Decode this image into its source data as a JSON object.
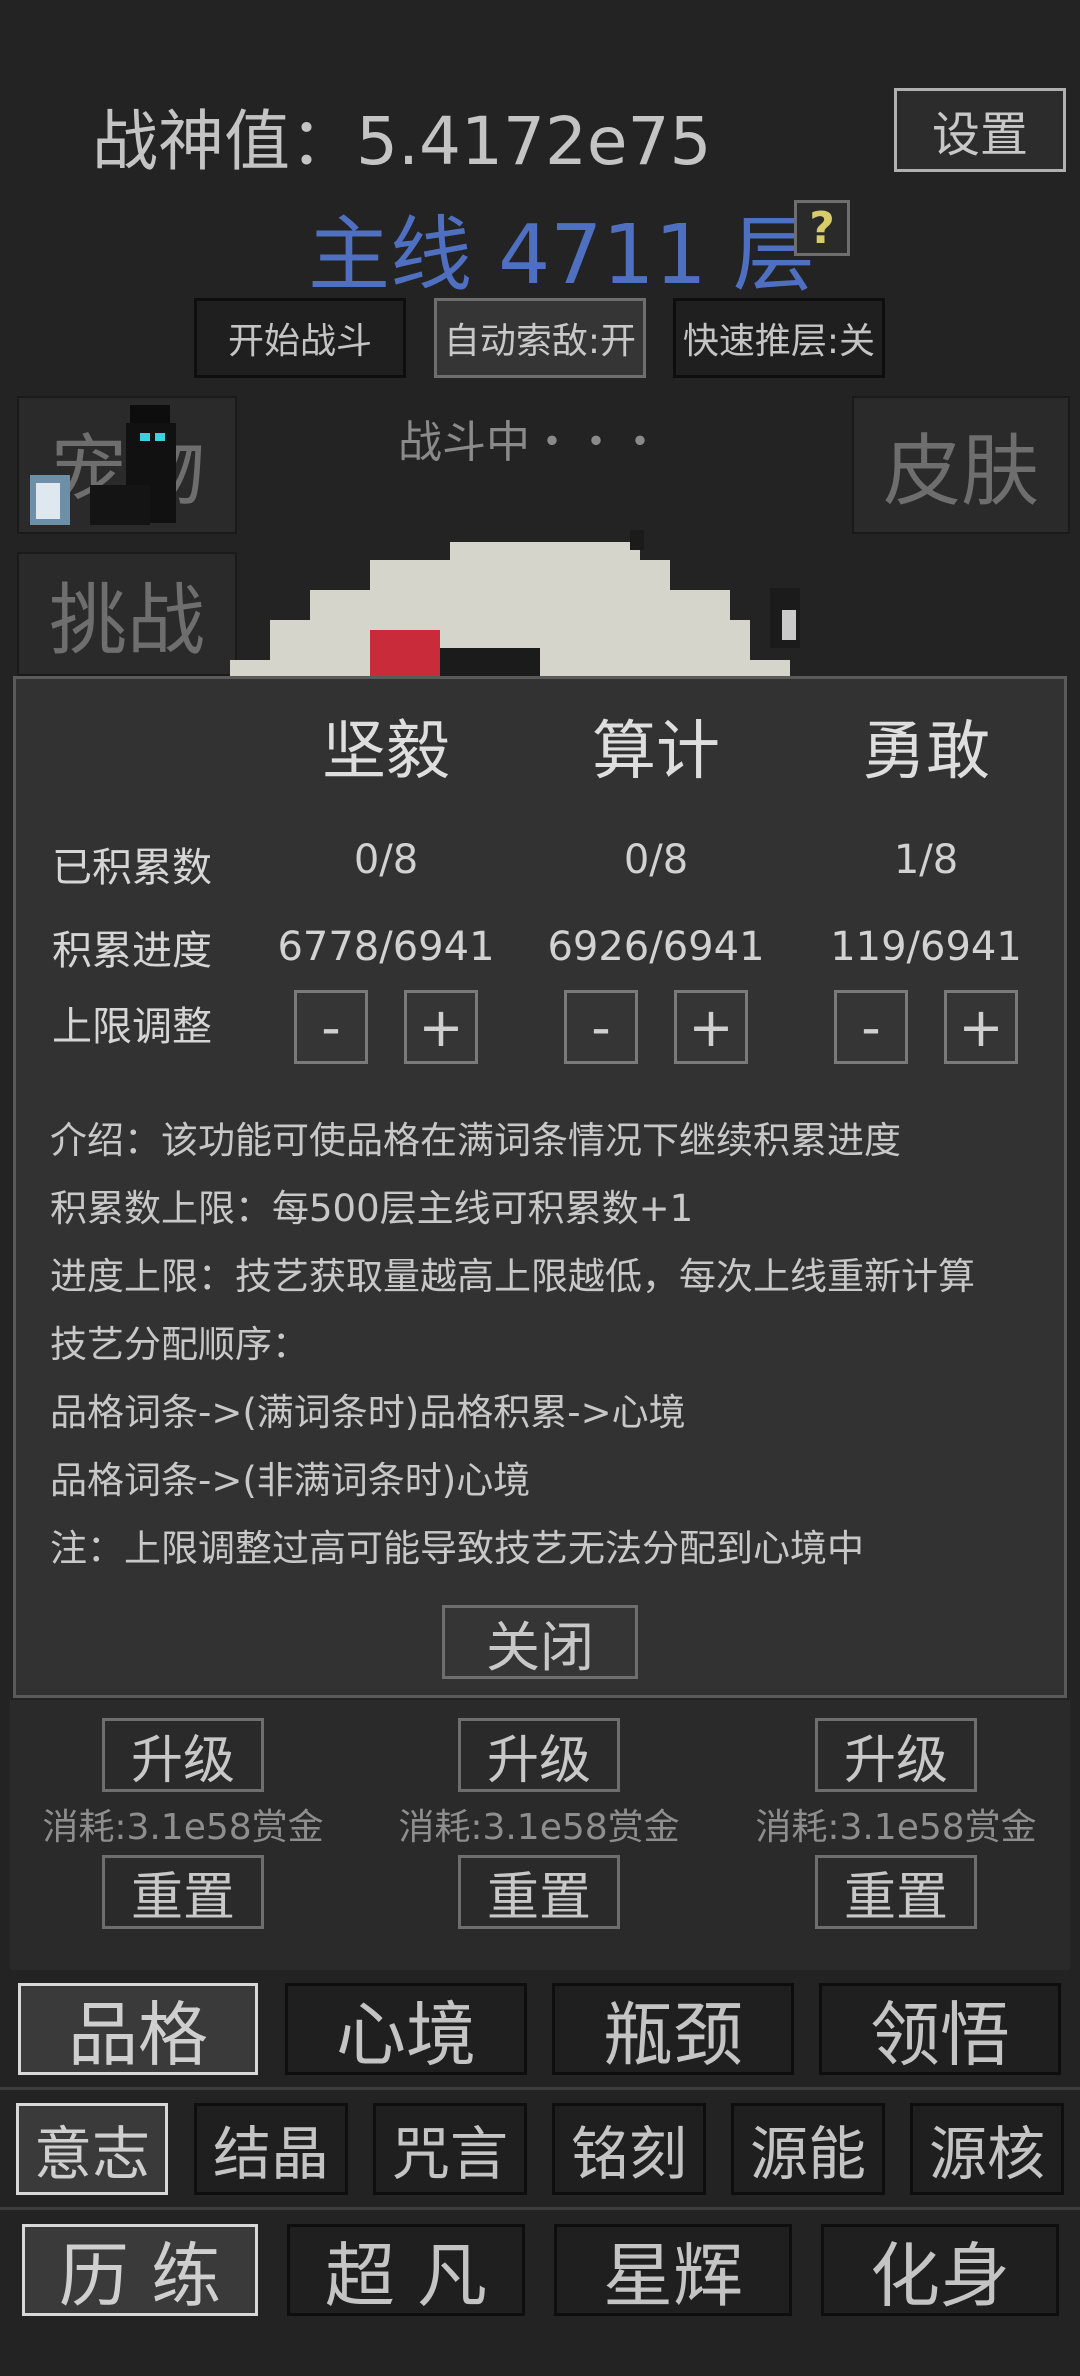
{
  "header": {
    "power_label": "战神值：5.4172e75",
    "settings": "设置",
    "main_line": "主线 4711 层",
    "help": "?"
  },
  "controls": {
    "start_battle": "开始战斗",
    "auto_target": "自动索敌:开",
    "fast_push": "快速推层:关"
  },
  "side": {
    "pet": "宠物",
    "skin": "皮肤",
    "challenge": "挑战",
    "status": "战斗中・・・"
  },
  "modal": {
    "columns": [
      "坚毅",
      "算计",
      "勇敢"
    ],
    "rows": {
      "accumulated": {
        "label": "已积累数",
        "values": [
          "0/8",
          "0/8",
          "1/8"
        ]
      },
      "progress": {
        "label": "积累进度",
        "values": [
          "6778/6941",
          "6926/6941",
          "119/6941"
        ]
      },
      "adjust": {
        "label": "上限调整",
        "minus": "-",
        "plus": "+"
      }
    },
    "info": [
      "介绍：该功能可使品格在满词条情况下继续积累进度",
      "积累数上限：每500层主线可积累数+1",
      "进度上限：技艺获取量越高上限越低，每次上线重新计算",
      "技艺分配顺序：",
      "品格词条->(满词条时)品格积累->心境",
      "品格词条->(非满词条时)心境",
      "注：上限调整过高可能导致技艺无法分配到心境中"
    ],
    "close": "关闭"
  },
  "upgrade": {
    "upgrade_label": "升级",
    "reset_label": "重置",
    "cost": "消耗:3.1e58赏金"
  },
  "tabs_row1": [
    "品格",
    "心境",
    "瓶颈",
    "领悟"
  ],
  "tabs_row2": [
    "意志",
    "结晶",
    "咒言",
    "铭刻",
    "源能",
    "源核"
  ],
  "tabs_row3": [
    "历 练",
    "超 凡",
    "星辉",
    "化身"
  ],
  "colors": {
    "main_line": "#4f6fc0",
    "help_bg": "#ded3a0",
    "modal_bg": "#323232"
  }
}
